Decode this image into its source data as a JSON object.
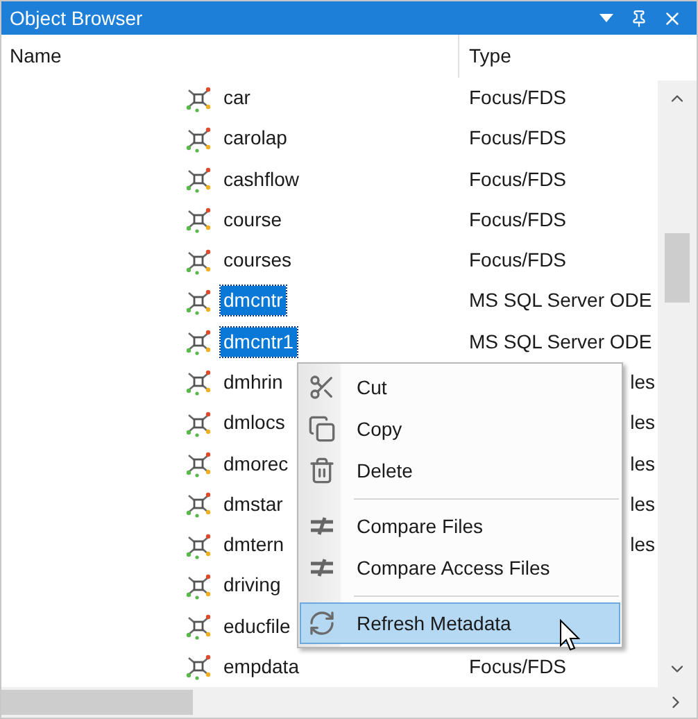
{
  "window": {
    "title": "Object Browser"
  },
  "columns": [
    "Name",
    "Type"
  ],
  "rows": [
    {
      "name": "car",
      "type": "Focus/FDS",
      "selected": false,
      "type_cut": false
    },
    {
      "name": "carolap",
      "type": "Focus/FDS",
      "selected": false,
      "type_cut": false
    },
    {
      "name": "cashflow",
      "type": "Focus/FDS",
      "selected": false,
      "type_cut": false
    },
    {
      "name": "course",
      "type": "Focus/FDS",
      "selected": false,
      "type_cut": false
    },
    {
      "name": "courses",
      "type": "Focus/FDS",
      "selected": false,
      "type_cut": false
    },
    {
      "name": "dmcntr",
      "type": "MS SQL Server ODE",
      "selected": true,
      "type_cut": false
    },
    {
      "name": "dmcntr1",
      "type": "MS SQL Server ODE",
      "selected": true,
      "type_cut": false
    },
    {
      "name": "dmhrin",
      "type": "les",
      "selected": false,
      "type_cut": true
    },
    {
      "name": "dmlocs",
      "type": "les",
      "selected": false,
      "type_cut": true
    },
    {
      "name": "dmorec",
      "type": "les",
      "selected": false,
      "type_cut": true
    },
    {
      "name": "dmstar",
      "type": "les",
      "selected": false,
      "type_cut": true
    },
    {
      "name": "dmtern",
      "type": "les",
      "selected": false,
      "type_cut": true
    },
    {
      "name": "driving",
      "selected": false
    },
    {
      "name": "educfile",
      "selected": false
    },
    {
      "name": "empdata",
      "type": "Focus/FDS",
      "selected": false,
      "type_cut": false
    }
  ],
  "context_menu": [
    {
      "kind": "item",
      "label": "Cut",
      "selected": false
    },
    {
      "kind": "item",
      "label": "Copy",
      "selected": false
    },
    {
      "kind": "item",
      "label": "Delete",
      "selected": false
    },
    {
      "kind": "separator"
    },
    {
      "kind": "item",
      "label": "Compare Files",
      "selected": false
    },
    {
      "kind": "item",
      "label": "Compare Access Files",
      "selected": false
    },
    {
      "kind": "separator"
    },
    {
      "kind": "item",
      "label": "Refresh Metadata",
      "selected": true
    }
  ]
}
